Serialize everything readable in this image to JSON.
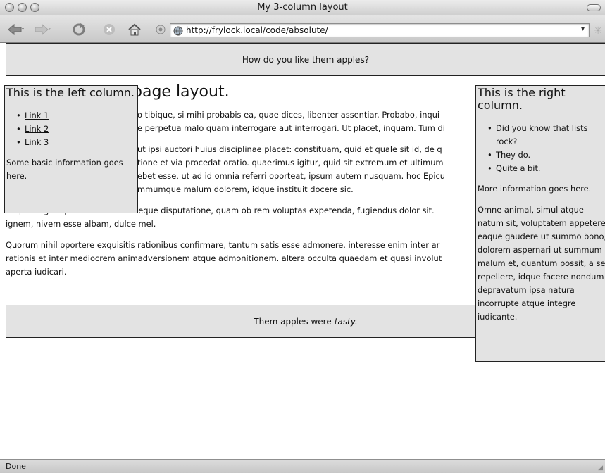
{
  "window": {
    "title": "My 3-column layout"
  },
  "toolbar": {
    "back_icon": "back-arrow-icon",
    "forward_icon": "forward-arrow-icon",
    "reload_icon": "reload-icon",
    "stop_icon": "stop-icon",
    "home_icon": "home-icon",
    "url": "http://frylock.local/code/absolute/",
    "dropdown_glyph": "▾"
  },
  "page": {
    "header_text": "How do you like them apples?",
    "heading_visible": "page layout.",
    "paragraphs": [
      {
        "lines": [
          "o tibique, si mihi probabis ea, quae dices, libenter assentiar. Probabo, inqui",
          "e perpetua malo quam interrogare aut interrogari. Ut placet, inquam. Tum di"
        ]
      },
      {
        "lines": [
          " ut ipsi auctori huius disciplinae placet: constituam, quid et quale sit id, de q",
          "tione et via procedat oratio. quaerimus igitur, quid sit extremum et ultimum",
          "ebet esse, ut ad id omnia referri oporteat, ipsum autem nusquam. hoc Epicu",
          "mmumque malum dolorem, idque instituit docere sic."
        ]
      },
      {
        "lines": [
          "Itaque negat opus esse ratione neque disputatione, quam ob rem voluptas expetenda, fugiendus dolor sit.",
          "ignem, nivem esse albam, dulce mel."
        ]
      },
      {
        "lines": [
          "Quorum nihil oportere exquisitis rationibus confirmare, tantum satis esse admonere. interesse enim inter ar",
          "rationis et inter mediocrem animadversionem atque admonitionem. altera occulta quaedam et quasi involut",
          "aperta iudicari."
        ]
      }
    ],
    "footer_text_prefix": "Them apples were",
    "footer_text_em": "tasty."
  },
  "left_column": {
    "title": "This is the left column.",
    "links": [
      "Link 1",
      "Link 2",
      "Link 3"
    ],
    "info": "Some basic information goes here."
  },
  "right_column": {
    "title": "This is the right column.",
    "items": [
      "Did you know that lists rock?",
      "They do.",
      "Quite a bit."
    ],
    "info": "More information goes here.",
    "paragraph": "Omne animal, simul atque natum sit, voluptatem appetere eaque gaudere ut summo bono, dolorem aspernari ut summum malum et, quantum possit, a se repellere, idque facere nondum depravatum ipsa natura incorrupte atque integre iudicante."
  },
  "statusbar": {
    "text": "Done"
  }
}
